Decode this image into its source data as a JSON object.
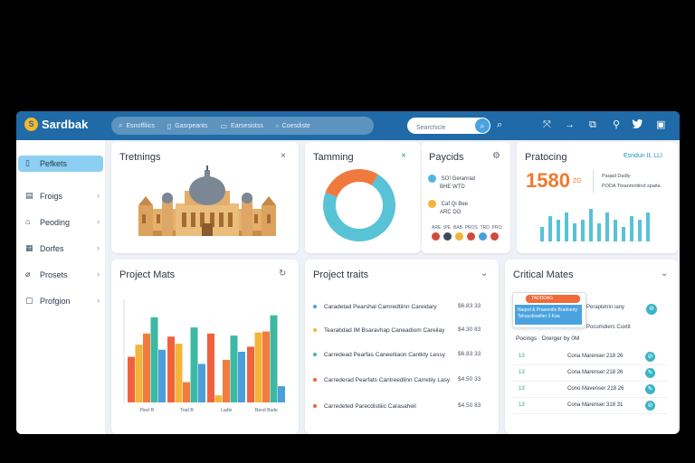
{
  "app": {
    "brand": "Sardbak",
    "logo_letter": "S"
  },
  "topbar": {
    "crumbs": [
      "Esnoffliics",
      "Gasrpeants",
      "Earsesistss",
      "Coesdiste"
    ],
    "search": {
      "value": "Searchicle"
    },
    "icons": [
      "search-icon",
      "expand-icon",
      "arrow-icon",
      "share-icon",
      "location-icon",
      "twitter-icon",
      "window-icon"
    ]
  },
  "sidebar": {
    "items": [
      {
        "label": "Pefkets",
        "icon": "file-icon",
        "active": true
      },
      {
        "label": "Froigs",
        "icon": "page-icon"
      },
      {
        "label": "Peoding",
        "icon": "lock-icon"
      },
      {
        "label": "Dorfes",
        "icon": "folder-icon"
      },
      {
        "label": "Prosets",
        "icon": "tag-icon"
      },
      {
        "label": "Profgion",
        "icon": "box-icon"
      }
    ]
  },
  "cards": {
    "trending": {
      "title": "Tretnings",
      "close": "×"
    },
    "tamming": {
      "title": "Tamming",
      "close": "×",
      "donut": {
        "segments": [
          72,
          28
        ],
        "colors": [
          "#58c3d6",
          "#f07a3e"
        ]
      }
    },
    "payments": {
      "title": "Paycids",
      "rows": [
        {
          "line1": "SO! Geranrad",
          "line2": "BHE WTD",
          "color": "#4fb6e0"
        },
        {
          "line1": "Caf Qi Bee",
          "line2": "ARC DO",
          "color": "#f3b437"
        }
      ],
      "tags": [
        "ARE",
        "tPE",
        "BAB",
        "PROS",
        "TRD",
        "PRO"
      ]
    },
    "pricing": {
      "title": "Pratocing",
      "link": "Esndun IL LLI",
      "big_number": "1580",
      "unit": "ZG",
      "sub1": "Paqad Dadly",
      "sub2": "PODA Tteanmntiind spaita",
      "bars": [
        4,
        7,
        6,
        8,
        5,
        6,
        9,
        5,
        8,
        6,
        4,
        7,
        6,
        8
      ]
    },
    "project_mats": {
      "title": "Project Mats",
      "xlabels": [
        "Pixel B",
        "Trad B",
        "Ladle",
        "Rend Bade"
      ],
      "chart_data": {
        "type": "bar",
        "categories": [
          "Pixel B",
          "Trad B",
          "Ladle",
          "Rend Bade"
        ],
        "series": [
          {
            "values": [
              45,
              65,
              68,
              55
            ],
            "color": "#f0623f"
          },
          {
            "values": [
              57,
              58,
              7,
              69
            ],
            "color": "#f4b33a"
          },
          {
            "values": [
              68,
              20,
              42,
              70
            ],
            "color": "#f27b3d"
          },
          {
            "values": [
              84,
              74,
              66,
              86
            ],
            "color": "#3db8a3"
          },
          {
            "values": [
              52,
              38,
              50,
              16
            ],
            "color": "#4a9fdb"
          }
        ],
        "ylim": [
          0,
          100
        ]
      }
    },
    "project_traits": {
      "title": "Project traits",
      "rows": [
        {
          "text": "Caradetad Pearshal Camredtiinn Careidary",
          "value": "$6.83 33",
          "color": "#4a9fdb"
        },
        {
          "text": "Tearabdad IM Bsaravhap Caneadiom Careilay",
          "value": "$4.30 83",
          "color": "#f4b33a"
        },
        {
          "text": "Carredead Pearfas Caneeitiaon Cantkty Lessy",
          "value": "$6.83 33",
          "color": "#3db8a3"
        },
        {
          "text": "Carrederad Pearfats Cantreedlinn Carretiiy Lasy",
          "value": "$4.50 33",
          "color": "#f0623f"
        },
        {
          "text": "Carredeted Parecdistiiic Carasaheil",
          "value": "$4.50 83",
          "color": "#f0623f"
        }
      ]
    },
    "critical": {
      "title": "Critical Mates",
      "popup": {
        "tag": "TADDDAG",
        "line1": "Narjed & Prasendls Bradoerty",
        "line2": "Teloacdeasfier 3 Kaa"
      },
      "side1": "Peraptetrin iany",
      "side2": "Pocumdiers Cuxtit",
      "section": "Pocings · Drerger by 0M",
      "rows": [
        {
          "id": "13",
          "text": "Cona Marenser 218 26",
          "icon": "link"
        },
        {
          "id": "13",
          "text": "Cona Marenser 218 26",
          "icon": "edit"
        },
        {
          "id": "13",
          "text": "Cono Mavenser 218 26",
          "icon": "edit"
        },
        {
          "id": "13",
          "text": "Cona Marenser 318 31",
          "icon": "link"
        }
      ]
    }
  }
}
